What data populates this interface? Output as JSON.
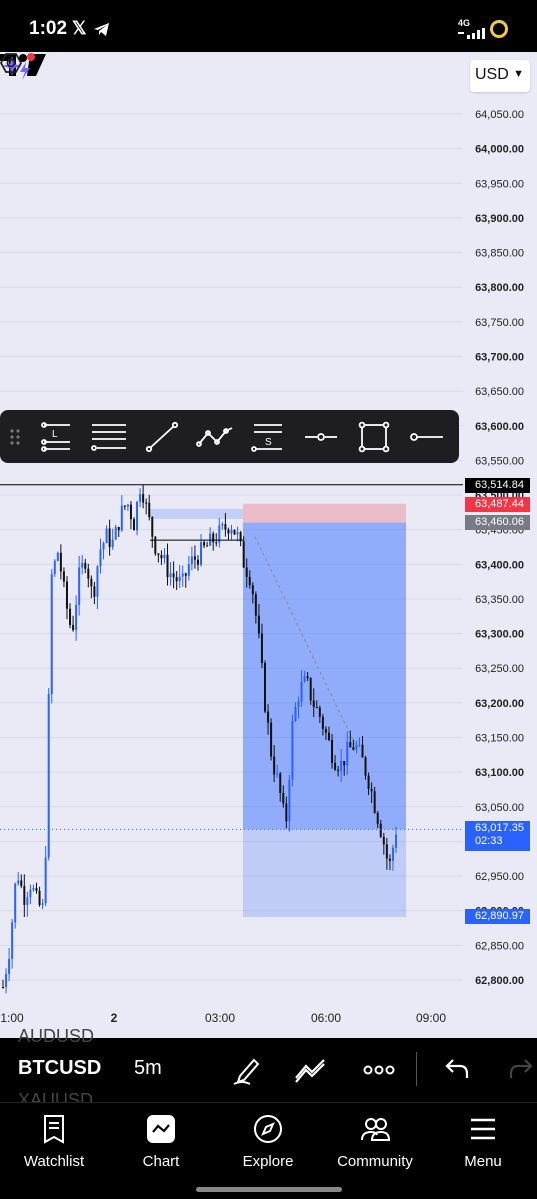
{
  "status_bar": {
    "time": "1:02",
    "network": "4G"
  },
  "chart": {
    "currency": "USD",
    "price_labels": [
      "64,050.00",
      "64,000.00",
      "63,950.00",
      "63,900.00",
      "63,850.00",
      "63,800.00",
      "63,750.00",
      "63,700.00",
      "63,650.00",
      "63,600.00",
      "63,550.00",
      "63,500.00",
      "63,450.00",
      "63,400.00",
      "63,350.00",
      "63,300.00",
      "63,250.00",
      "63,200.00",
      "63,150.00",
      "63,100.00",
      "63,050.00",
      "63,000.00",
      "62,950.00",
      "62,900.00",
      "62,850.00",
      "62,800.00"
    ],
    "time_labels": [
      "1:00",
      "2",
      "03:00",
      "06:00",
      "09:00"
    ],
    "tags": {
      "line_price": "63,514.84",
      "stop_price": "63,487.44",
      "entry_price": "63,460.06",
      "last_price": "63,017.35",
      "countdown": "02:33",
      "target_price": "62,890.97"
    },
    "colors": {
      "up": "#2962ff",
      "down": "#111111",
      "stop": "#f23645",
      "entry": "#787b86",
      "last": "#2962ff"
    }
  },
  "chart_data": {
    "type": "candlestick",
    "symbol": "BTCUSD",
    "interval": "5m",
    "ylim": [
      62780,
      64080
    ],
    "x_ticks": [
      "1:00",
      "2",
      "03:00",
      "06:00",
      "09:00"
    ],
    "close_path": [
      62790,
      62850,
      62960,
      62920,
      62940,
      62910,
      62900,
      63380,
      63420,
      63350,
      63300,
      63380,
      63410,
      63350,
      63420,
      63440,
      63430,
      63470,
      63490,
      63460,
      63520,
      63470,
      63430,
      63410,
      63390,
      63380,
      63370,
      63400,
      63410,
      63420,
      63430,
      63440,
      63450,
      63460,
      63440,
      63400,
      63380,
      63300,
      63200,
      63120,
      63080,
      63020,
      63170,
      63220,
      63230,
      63200,
      63180,
      63150,
      63120,
      63110,
      63130,
      63140,
      63120,
      63090,
      63050,
      63010,
      62960,
      63017.35
    ],
    "position": {
      "type": "short",
      "entry": 63460.06,
      "stop": 63487.44,
      "target": 62890.97
    },
    "horizontal_line": 63514.84
  },
  "drawing_toolbar": {
    "tools": [
      "long-position",
      "short-lines",
      "trend-line",
      "path",
      "short-position",
      "horizontal-ray",
      "rectangle",
      "horizontal-line"
    ]
  },
  "bottom_toolbar": {
    "symbol": "BTCUSD",
    "interval": "5m",
    "ghost_above": "AUDUSD",
    "ghost_below": "XAUUSD"
  },
  "tabs": [
    {
      "label": "Watchlist"
    },
    {
      "label": "Chart"
    },
    {
      "label": "Explore"
    },
    {
      "label": "Community"
    },
    {
      "label": "Menu"
    }
  ]
}
